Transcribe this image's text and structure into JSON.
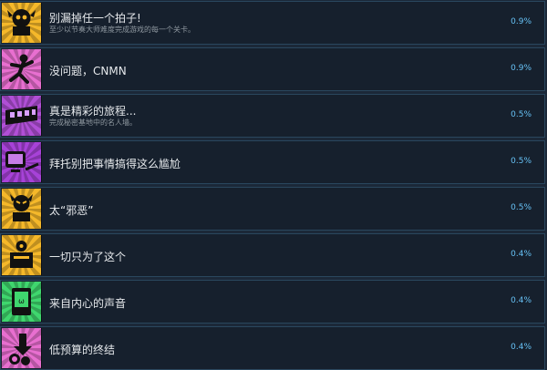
{
  "achievements": [
    {
      "title": "别漏掉任一个拍子!",
      "description": "至少以节奏大师难度完成游戏的每一个关卡。",
      "percent": "0.9%",
      "icon": "skull-trophy-icon",
      "color": "#f5b82a"
    },
    {
      "title": "没问题，CNMN",
      "description": "",
      "percent": "0.9%",
      "icon": "figure-icon",
      "color": "#e86fd0"
    },
    {
      "title": "真是精彩的旅程...",
      "description": "完成秘密基地中的名人墙。",
      "percent": "0.5%",
      "icon": "wall-icon",
      "color": "#b04fd6"
    },
    {
      "title": "拜托别把事情搞得这么尴尬",
      "description": "",
      "percent": "0.5%",
      "icon": "screen-icon",
      "color": "#a742d8"
    },
    {
      "title": "太“邪恶”",
      "description": "",
      "percent": "0.5%",
      "icon": "evil-trophy-icon",
      "color": "#f5b82a"
    },
    {
      "title": "一切只为了这个",
      "description": "",
      "percent": "0.4%",
      "icon": "treasure-icon",
      "color": "#f5b82a"
    },
    {
      "title": "来自内心的声音",
      "description": "",
      "percent": "0.4%",
      "icon": "device-icon",
      "color": "#3fd66e"
    },
    {
      "title": "低预算的终结",
      "description": "",
      "percent": "0.4%",
      "icon": "coins-icon",
      "color": "#e86fd0"
    }
  ]
}
